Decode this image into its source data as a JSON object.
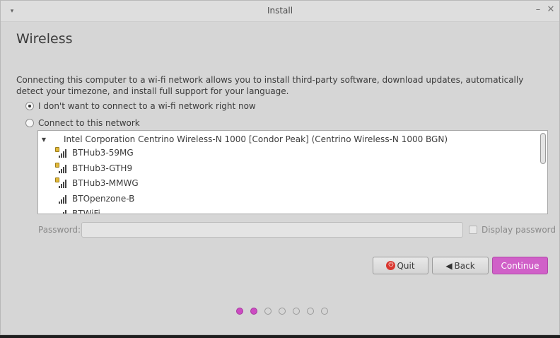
{
  "window": {
    "title": "Install",
    "menu_glyph": "▾",
    "minimize_glyph": "–",
    "close_glyph": "✕"
  },
  "page": {
    "heading": "Wireless",
    "description": "Connecting this computer to a wi-fi network allows you to install third-party software, download updates, automatically detect your timezone, and install full support for your language."
  },
  "options": {
    "no_wifi_label": "I don't want to connect to a wi-fi network right now",
    "no_wifi_selected": true,
    "connect_label": "Connect to this network",
    "connect_selected": false
  },
  "networks": {
    "adapter": "Intel Corporation Centrino Wireless-N 1000 [Condor Peak] (Centrino Wireless-N 1000 BGN)",
    "items": [
      {
        "name": "BTHub3-59MG",
        "secured": true,
        "signal_icon": "wifi-signal-icon"
      },
      {
        "name": "BTHub3-GTH9",
        "secured": true,
        "signal_icon": "wifi-signal-icon"
      },
      {
        "name": "BTHub3-MMWG",
        "secured": true,
        "signal_icon": "wifi-signal-icon"
      },
      {
        "name": "BTOpenzone-B",
        "secured": false,
        "signal_icon": "wifi-signal-icon"
      },
      {
        "name": "BTWiFi",
        "secured": false,
        "signal_icon": "wifi-signal-icon"
      }
    ]
  },
  "password": {
    "label": "Password:",
    "value": "",
    "display_label": "Display password",
    "display_checked": false
  },
  "buttons": {
    "quit": "Quit",
    "back": "Back",
    "continue": "Continue"
  },
  "progress": {
    "total_steps": 7,
    "completed_steps": 2
  },
  "colors": {
    "accent": "#d060c8",
    "quit_icon": "#d9362f"
  }
}
